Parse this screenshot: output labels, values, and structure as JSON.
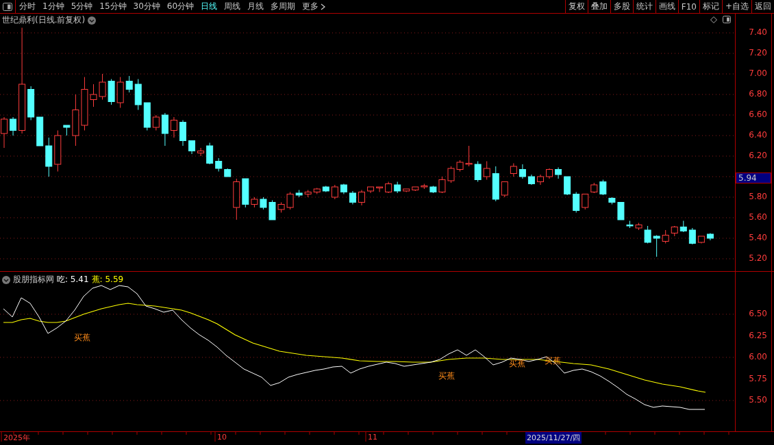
{
  "toolbar": {
    "periods": [
      {
        "label": "分时",
        "selected": false
      },
      {
        "label": "1分钟",
        "selected": false
      },
      {
        "label": "5分钟",
        "selected": false
      },
      {
        "label": "15分钟",
        "selected": false
      },
      {
        "label": "30分钟",
        "selected": false
      },
      {
        "label": "60分钟",
        "selected": false
      },
      {
        "label": "日线",
        "selected": true
      },
      {
        "label": "周线",
        "selected": false
      },
      {
        "label": "月线",
        "selected": false
      },
      {
        "label": "多周期",
        "selected": false
      },
      {
        "label": "更多",
        "selected": false
      }
    ],
    "actions": [
      "复权",
      "叠加",
      "多股",
      "统计",
      "画线",
      "F10",
      "标记",
      "+自选",
      "返回"
    ]
  },
  "chart": {
    "title": "世纪鼎利(日线.前复权)",
    "price_axis": [
      "7.40",
      "7.20",
      "7.00",
      "6.80",
      "6.60",
      "6.40",
      "6.20",
      "5.80",
      "5.60",
      "5.40",
      "5.20"
    ],
    "last_price": "5.94"
  },
  "indicator": {
    "name": "股朋指标网",
    "legend": [
      {
        "label": "吃: 5.41",
        "color": "#ffffff"
      },
      {
        "label": "蕉: 5.59",
        "color": "#ffff00"
      }
    ],
    "signals": [
      {
        "label": "买蕉"
      },
      {
        "label": "买蕉"
      },
      {
        "label": "买蕉"
      },
      {
        "label": "买蕉"
      }
    ],
    "axis": [
      "6.50",
      "6.25",
      "6.00",
      "5.75",
      "5.50"
    ]
  },
  "date_axis": {
    "labels": [
      "2025年",
      "10",
      "11"
    ],
    "cursor_date": "2025/11/27/四"
  }
}
